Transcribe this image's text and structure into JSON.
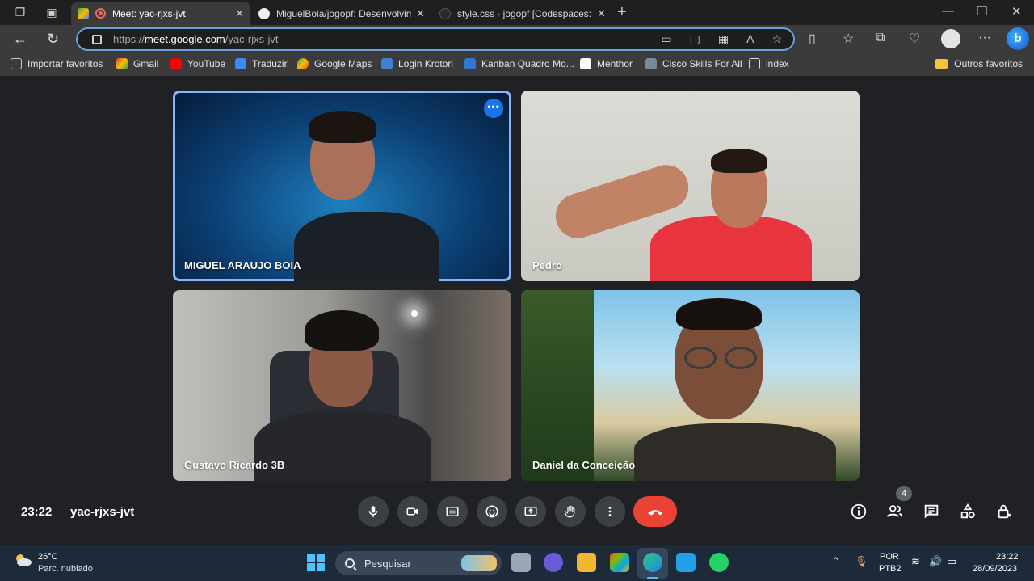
{
  "browser": {
    "tabs": [
      {
        "title": "Meet: yac-rjxs-jvt",
        "active": true
      },
      {
        "title": "MiguelBoia/jogopf: Desenvolvim",
        "active": false
      },
      {
        "title": "style.css - jogopf [Codespaces: p",
        "active": false
      }
    ],
    "url": {
      "proto": "https://",
      "host": "meet.google.com",
      "path": "/yac-rjxs-jvt"
    },
    "bookmarks": [
      "Importar favoritos",
      "Gmail",
      "YouTube",
      "Traduzir",
      "Google Maps",
      "Login Kroton",
      "Kanban Quadro Mo...",
      "Menthor",
      "Cisco Skills For All",
      "index"
    ],
    "other_favorites": "Outros favoritos"
  },
  "meet": {
    "participants": [
      {
        "name": "MIGUEL ARAUJO BOIA"
      },
      {
        "name": "Pedro"
      },
      {
        "name": "Gustavo Ricardo 3B"
      },
      {
        "name": "Daniel da Conceição"
      }
    ],
    "time": "23:22",
    "meeting_code": "yac-rjxs-jvt",
    "participant_count": "4",
    "more_options_glyph": "•••"
  },
  "taskbar": {
    "temperature": "26°C",
    "weather": "Parc. nublado",
    "search_placeholder": "Pesquisar",
    "lang_1": "POR",
    "lang_2": "PTB2",
    "time": "23:22",
    "date": "28/09/2023"
  },
  "colors": {
    "accent": "#8ab4f8",
    "end_call": "#ea4335",
    "meet_bg": "#202124",
    "control_bg": "#3c4043"
  }
}
